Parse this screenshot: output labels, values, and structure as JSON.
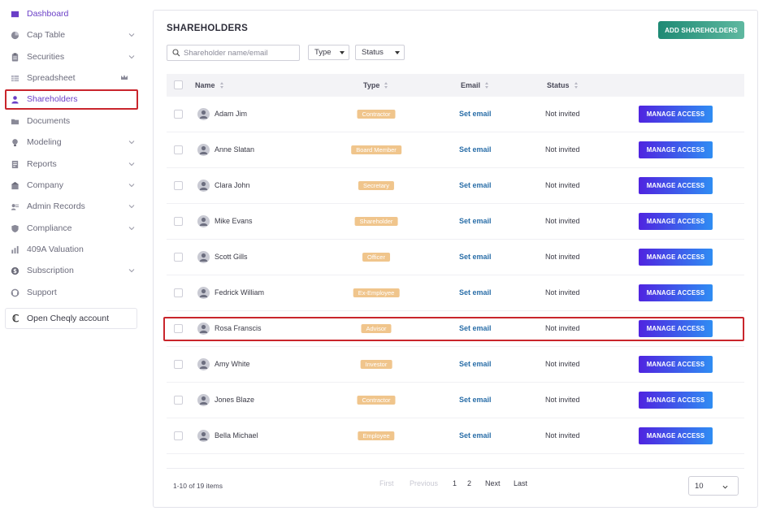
{
  "sidebar": {
    "items": [
      {
        "label": "Dashboard",
        "icon": "dashboard-icon",
        "expandable": false
      },
      {
        "label": "Cap Table",
        "icon": "pie-chart-icon",
        "expandable": true
      },
      {
        "label": "Securities",
        "icon": "clipboard-icon",
        "expandable": true
      },
      {
        "label": "Spreadsheet",
        "icon": "spreadsheet-icon",
        "expandable": false,
        "badge_icon": "crown-icon"
      },
      {
        "label": "Shareholders",
        "icon": "user-icon",
        "expandable": false
      },
      {
        "label": "Documents",
        "icon": "folder-icon",
        "expandable": false
      },
      {
        "label": "Modeling",
        "icon": "lightbulb-icon",
        "expandable": true
      },
      {
        "label": "Reports",
        "icon": "report-icon",
        "expandable": true
      },
      {
        "label": "Company",
        "icon": "building-icon",
        "expandable": true
      },
      {
        "label": "Admin Records",
        "icon": "records-icon",
        "expandable": true
      },
      {
        "label": "Compliance",
        "icon": "shield-icon",
        "expandable": true
      },
      {
        "label": "409A Valuation",
        "icon": "bar-chart-icon",
        "expandable": false
      },
      {
        "label": "Subscription",
        "icon": "dollar-icon",
        "expandable": true
      },
      {
        "label": "Support",
        "icon": "support-icon",
        "expandable": false
      }
    ],
    "cheqly_label": "Open Cheqly account"
  },
  "main": {
    "title": "SHAREHOLDERS",
    "add_button": "ADD SHAREHOLDERS",
    "search_placeholder": "Shareholder name/email",
    "type_filter": "Type",
    "status_filter": "Status",
    "columns": [
      "Name",
      "Type",
      "Email",
      "Status"
    ],
    "rows": [
      {
        "name": "Adam Jim",
        "type": "Contractor",
        "email": "Set email",
        "status": "Not invited",
        "action": "MANAGE ACCESS"
      },
      {
        "name": "Anne Slatan",
        "type": "Board Member",
        "email": "Set email",
        "status": "Not invited",
        "action": "MANAGE ACCESS"
      },
      {
        "name": "Clara John",
        "type": "Secretary",
        "email": "Set email",
        "status": "Not invited",
        "action": "MANAGE ACCESS"
      },
      {
        "name": "Mike Evans",
        "type": "Shareholder",
        "email": "Set email",
        "status": "Not invited",
        "action": "MANAGE ACCESS"
      },
      {
        "name": "Scott Gills",
        "type": "Officer",
        "email": "Set email",
        "status": "Not invited",
        "action": "MANAGE ACCESS"
      },
      {
        "name": "Fedrick William",
        "type": "Ex-Employee",
        "email": "Set email",
        "status": "Not invited",
        "action": "MANAGE ACCESS"
      },
      {
        "name": "Rosa Franscis",
        "type": "Advisor",
        "email": "Set email",
        "status": "Not invited",
        "action": "MANAGE ACCESS"
      },
      {
        "name": "Amy White",
        "type": "Investor",
        "email": "Set email",
        "status": "Not invited",
        "action": "MANAGE ACCESS"
      },
      {
        "name": "Jones Blaze",
        "type": "Contractor",
        "email": "Set email",
        "status": "Not invited",
        "action": "MANAGE ACCESS"
      },
      {
        "name": "Bella Michael",
        "type": "Employee",
        "email": "Set email",
        "status": "Not invited",
        "action": "MANAGE ACCESS"
      }
    ],
    "pagination": {
      "count_text": "1-10 of 19 items",
      "first": "First",
      "previous": "Previous",
      "page1": "1",
      "page2": "2",
      "next": "Next",
      "last": "Last",
      "page_size": "10"
    }
  },
  "colors": {
    "accent": "#6a3fc7",
    "highlight": "#c9252c",
    "badge": "#f0c58c",
    "link": "#2a6ea8"
  }
}
